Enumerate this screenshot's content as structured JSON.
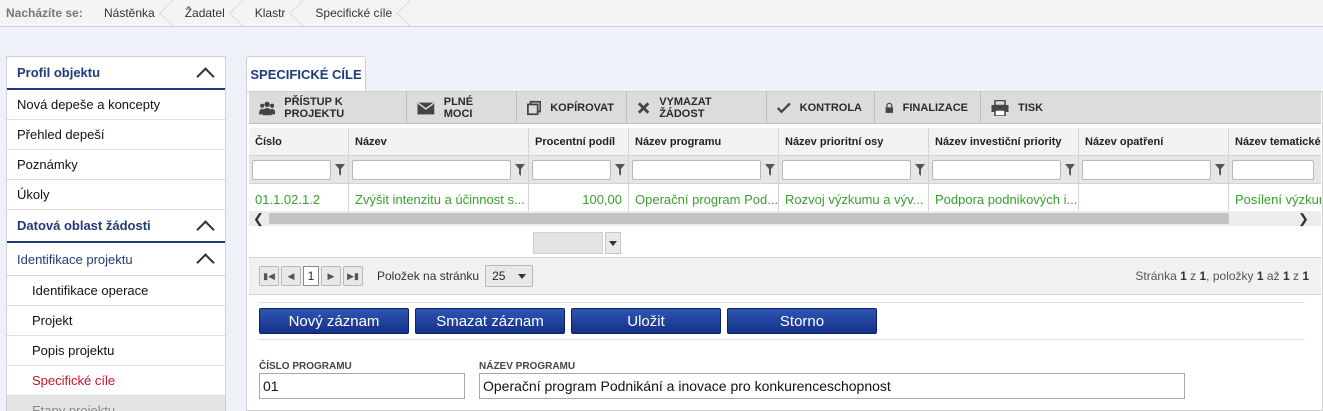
{
  "breadcrumb": {
    "lead": "Nacházíte se:",
    "items": [
      "Nástěnka",
      "Žadatel",
      "Klastr",
      "Specifické cíle"
    ]
  },
  "sidebar": {
    "profil_title": "Profil objektu",
    "profil_items": [
      "Nová depeše a koncepty",
      "Přehled depeší",
      "Poznámky",
      "Úkoly"
    ],
    "datova_title": "Datová oblast žádosti",
    "identifikace_title": "Identifikace projektu",
    "identifikace_items": [
      "Identifikace operace",
      "Projekt",
      "Popis projektu",
      "Specifické cíle",
      "Etapy projektu"
    ]
  },
  "tab": {
    "label": "SPECIFICKÉ CÍLE"
  },
  "toolbar": {
    "pristup": "PŘÍSTUP K PROJEKTU",
    "plne_moci": "PLNÉ MOCI",
    "kopirovat": "KOPÍROVAT",
    "vymazat": "VYMAZAT ŽÁDOST",
    "kontrola": "KONTROLA",
    "finalizace": "FINALIZACE",
    "tisk": "TISK"
  },
  "grid": {
    "columns": [
      "Číslo",
      "Název",
      "Procentní podíl",
      "Název programu",
      "Název prioritní osy",
      "Název investiční priority",
      "Název opatření",
      "Název tematického"
    ],
    "rows": [
      [
        "01.1.02.1.2",
        "Zvýšit intenzitu a účinnost s...",
        "100,00",
        "Operační program Pod...",
        "Rozvoj výzkumu a výv...",
        "Podpora podnikových i...",
        "",
        "Posílení výzkumu"
      ]
    ]
  },
  "pager": {
    "current_page": "1",
    "per_page_label": "Položek na stránku",
    "per_page_value": "25",
    "info_prefix": "Stránka",
    "info_page": "1",
    "info_z1": "z",
    "info_total_pages": "1",
    "info_items": "položky",
    "info_from": "1",
    "info_az": "až",
    "info_to": "1",
    "info_z2": "z",
    "info_total": "1"
  },
  "actions": {
    "new": "Nový záznam",
    "delete": "Smazat záznam",
    "save": "Uložit",
    "cancel": "Storno"
  },
  "form": {
    "cislo_label": "ČÍSLO PROGRAMU",
    "cislo_value": "01",
    "nazev_label": "NÁZEV PROGRAMU",
    "nazev_value": "Operační program Podnikání a inovace pro konkurenceschopnost"
  },
  "colors": {
    "navy": "#1f3b7a",
    "active_red": "#c8102e",
    "data_green": "#3aa02f",
    "button_blue": "#1f3f9a"
  }
}
